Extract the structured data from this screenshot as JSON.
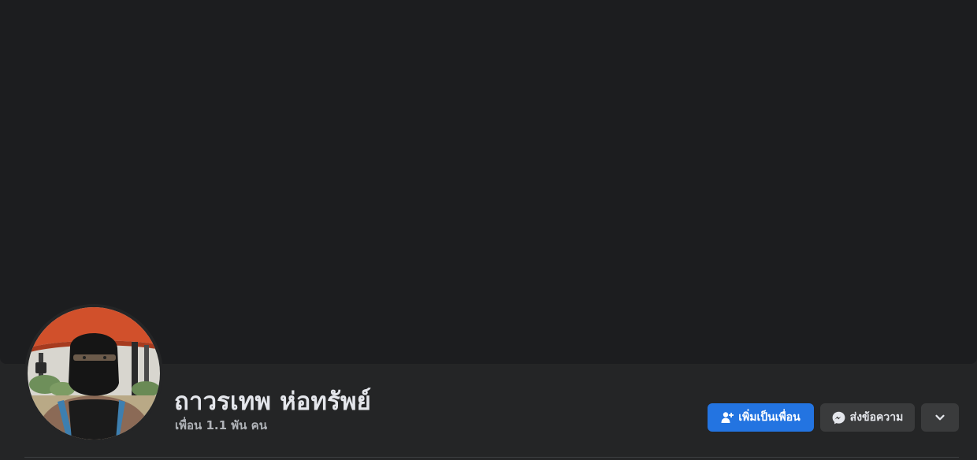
{
  "profile": {
    "name": "ถาวรเทพ ห่อทรัพย์",
    "friends_count": "เพื่อน 1.1 พัน คน",
    "avatar_alt": "profile-photo"
  },
  "actions": {
    "add_friend_label": "เพิ่มเป็นเพื่อน",
    "add_friend_icon": "add-friend-icon",
    "message_label": "ส่งข้อความ",
    "message_icon": "messenger-icon",
    "more_icon": "chevron-down-icon"
  },
  "colors": {
    "primary": "#2374e1",
    "surface": "#242526",
    "cover": "#1c1d1f",
    "secondary_button": "#3a3b3c",
    "text_primary": "#e4e6eb",
    "text_secondary": "#b0b3b8"
  }
}
